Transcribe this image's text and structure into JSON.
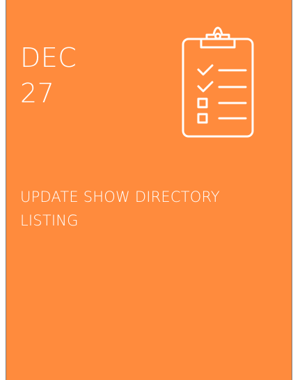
{
  "card": {
    "background_color": "#FF8B3D",
    "month": "DEC",
    "day": "27",
    "title": "UPDATE SHOW DIRECTORY LISTING",
    "icon": "clipboard-checklist-icon"
  }
}
